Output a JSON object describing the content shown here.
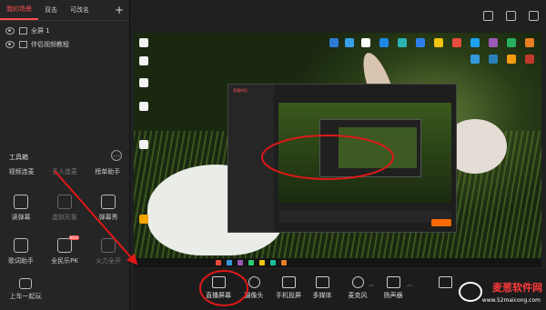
{
  "scene_tabs": [
    "我的场景",
    "双击",
    "可改名"
  ],
  "sources": [
    "全屏 1",
    "伴侣视频教程"
  ],
  "toolbox": {
    "title": "工具箱",
    "tabs": [
      "视频连麦",
      "多人连麦",
      "榜单助手"
    ],
    "tools": [
      "读弹幕",
      "虚拟形象",
      "弹幕秀",
      "歌词助手",
      "全民乐PK",
      "火力全开"
    ],
    "badge": "NEW"
  },
  "bottom_left": "上车一起玩",
  "bottom_bar": [
    "直播屏幕",
    "摄像头",
    "手机投屏",
    "多媒体",
    "麦克风",
    "扬声器"
  ],
  "watermark": {
    "name": "麦葱软件网",
    "url": "www.52maicong.com"
  },
  "nested_title": "直播伴侣",
  "colors": {
    "accent": "#ff4d4f",
    "annotation": "#e01818"
  }
}
